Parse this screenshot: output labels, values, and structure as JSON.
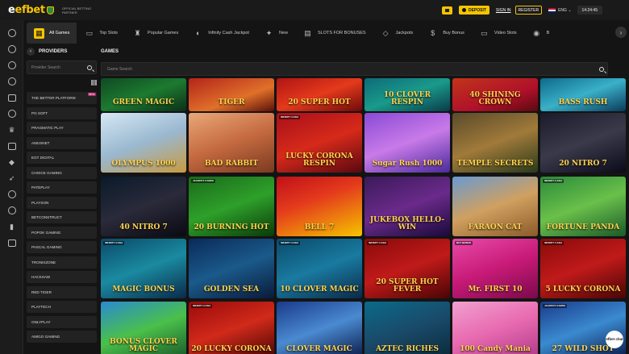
{
  "brand": {
    "logo": "efbet",
    "partner_text": "OFFICIAL BETTING PARTNER"
  },
  "header": {
    "deposit_label": "DEPOSIT",
    "signin_label": "SIGN IN",
    "register_label": "REGISTER",
    "language": "ENG",
    "clock": "14:24:45"
  },
  "rail_icons": [
    "home-icon",
    "clock-icon",
    "star-icon",
    "ball-icon",
    "cards-icon",
    "target-icon",
    "trophy-icon",
    "screen-icon",
    "dice-icon",
    "rocket-icon",
    "crown-icon",
    "chip-icon",
    "chart-icon",
    "gift-icon"
  ],
  "categories": [
    {
      "label": "All Games",
      "icon": "grid-icon",
      "active": true
    },
    {
      "label": "Top Slots",
      "icon": "slot-icon"
    },
    {
      "label": "Popular Games",
      "icon": "trophy-icon"
    },
    {
      "label": "Infinity Cash Jackpot",
      "icon": "infinity-icon"
    },
    {
      "label": "New",
      "icon": "star-icon"
    },
    {
      "label": "SLOTS FOR BONUSES",
      "icon": "bonus-icon"
    },
    {
      "label": "Jackpots",
      "icon": "diamond-icon"
    },
    {
      "label": "Buy Bonus",
      "icon": "bag-icon"
    },
    {
      "label": "Video Slots",
      "icon": "video-icon"
    },
    {
      "label": "B",
      "icon": "chip-icon"
    }
  ],
  "providers": {
    "title": "PROVIDERS",
    "search_placeholder": "Provider Search",
    "items": [
      "THE BETTER PLATFORM",
      "PG SOFT",
      "PRAGMATIC PLAY",
      "AMUSNET",
      "EGT DIGITAL",
      "CHOICE GAMING",
      "PATEPLAY",
      "PLAYSON",
      "BETCONSTRUCT",
      "POPOK GAMING",
      "PASCAL GAMING",
      "TRONIXZONE",
      "HACKSAW",
      "RED TIGER",
      "PLAYTECH",
      "ONLYPLAY",
      "AMIGO GAMING"
    ],
    "new_badge": "NEW"
  },
  "games": {
    "title": "GAMES",
    "search_placeholder": "Game Search",
    "rows": [
      [
        {
          "title": "GREEN MAGIC"
        },
        {
          "title": "TIGER"
        },
        {
          "title": "20 SUPER HOT"
        },
        {
          "title": "10 CLOVER RESPIN"
        },
        {
          "title": "40 SHINING CROWN"
        },
        {
          "title": "BASS RUSH"
        }
      ],
      [
        {
          "title": "OLYMPUS 1000"
        },
        {
          "title": "BAD RABBIT"
        },
        {
          "title": "LUCKY CORONA RESPIN",
          "badge": "INFINITY CASH"
        },
        {
          "title": "Sugar Rush 1000"
        },
        {
          "title": "TEMPLE SECRETS"
        },
        {
          "title": "20 NITRO 7"
        }
      ],
      [
        {
          "title": "40 NITRO 7"
        },
        {
          "title": "20 BURNING HOT",
          "badge": "JACKPOT CARDS"
        },
        {
          "title": "BELL 7"
        },
        {
          "title": "JUKEBOX HELLO-WIN"
        },
        {
          "title": "FARAON CAT"
        },
        {
          "title": "FORTUNE PANDA",
          "badge": "INFINITY CASH"
        }
      ],
      [
        {
          "title": "MAGIC BONUS",
          "badge": "INFINITY CASH"
        },
        {
          "title": "GOLDEN SEA"
        },
        {
          "title": "10 CLOVER MAGIC",
          "badge": "INFINITY CASH"
        },
        {
          "title": "20 SUPER HOT FEVER",
          "badge": "INFINITY CASH"
        },
        {
          "title": "Mr. FIRST 10",
          "badge": "BUY BONUS"
        },
        {
          "title": "5 LUCKY CORONA",
          "badge": "INFINITY CASH"
        }
      ],
      [
        {
          "title": "BONUS CLOVER MAGIC"
        },
        {
          "title": "20 LUCKY CORONA",
          "badge": "INFINITY CASH"
        },
        {
          "title": "CLOVER MAGIC"
        },
        {
          "title": "AZTEC RICHES"
        },
        {
          "title": "100 Candy Mania"
        },
        {
          "title": "27 WILD SHOT",
          "badge": "JACKPOT CARDS"
        }
      ]
    ]
  },
  "chat_label": "efbet chat"
}
